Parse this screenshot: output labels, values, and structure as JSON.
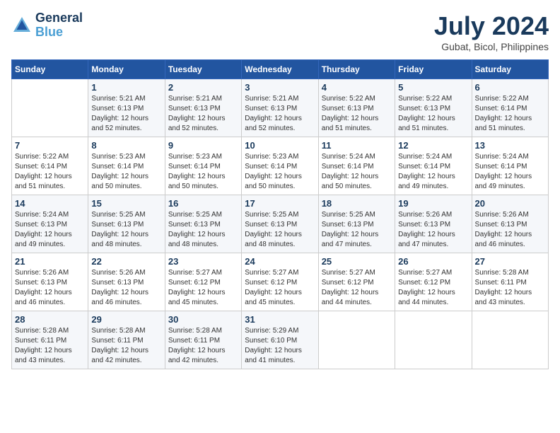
{
  "header": {
    "logo_line1": "General",
    "logo_line2": "Blue",
    "month_title": "July 2024",
    "location": "Gubat, Bicol, Philippines"
  },
  "days_of_week": [
    "Sunday",
    "Monday",
    "Tuesday",
    "Wednesday",
    "Thursday",
    "Friday",
    "Saturday"
  ],
  "weeks": [
    [
      {
        "day": "",
        "info": ""
      },
      {
        "day": "1",
        "info": "Sunrise: 5:21 AM\nSunset: 6:13 PM\nDaylight: 12 hours\nand 52 minutes."
      },
      {
        "day": "2",
        "info": "Sunrise: 5:21 AM\nSunset: 6:13 PM\nDaylight: 12 hours\nand 52 minutes."
      },
      {
        "day": "3",
        "info": "Sunrise: 5:21 AM\nSunset: 6:13 PM\nDaylight: 12 hours\nand 52 minutes."
      },
      {
        "day": "4",
        "info": "Sunrise: 5:22 AM\nSunset: 6:13 PM\nDaylight: 12 hours\nand 51 minutes."
      },
      {
        "day": "5",
        "info": "Sunrise: 5:22 AM\nSunset: 6:13 PM\nDaylight: 12 hours\nand 51 minutes."
      },
      {
        "day": "6",
        "info": "Sunrise: 5:22 AM\nSunset: 6:14 PM\nDaylight: 12 hours\nand 51 minutes."
      }
    ],
    [
      {
        "day": "7",
        "info": "Sunrise: 5:22 AM\nSunset: 6:14 PM\nDaylight: 12 hours\nand 51 minutes."
      },
      {
        "day": "8",
        "info": "Sunrise: 5:23 AM\nSunset: 6:14 PM\nDaylight: 12 hours\nand 50 minutes."
      },
      {
        "day": "9",
        "info": "Sunrise: 5:23 AM\nSunset: 6:14 PM\nDaylight: 12 hours\nand 50 minutes."
      },
      {
        "day": "10",
        "info": "Sunrise: 5:23 AM\nSunset: 6:14 PM\nDaylight: 12 hours\nand 50 minutes."
      },
      {
        "day": "11",
        "info": "Sunrise: 5:24 AM\nSunset: 6:14 PM\nDaylight: 12 hours\nand 50 minutes."
      },
      {
        "day": "12",
        "info": "Sunrise: 5:24 AM\nSunset: 6:14 PM\nDaylight: 12 hours\nand 49 minutes."
      },
      {
        "day": "13",
        "info": "Sunrise: 5:24 AM\nSunset: 6:14 PM\nDaylight: 12 hours\nand 49 minutes."
      }
    ],
    [
      {
        "day": "14",
        "info": "Sunrise: 5:24 AM\nSunset: 6:13 PM\nDaylight: 12 hours\nand 49 minutes."
      },
      {
        "day": "15",
        "info": "Sunrise: 5:25 AM\nSunset: 6:13 PM\nDaylight: 12 hours\nand 48 minutes."
      },
      {
        "day": "16",
        "info": "Sunrise: 5:25 AM\nSunset: 6:13 PM\nDaylight: 12 hours\nand 48 minutes."
      },
      {
        "day": "17",
        "info": "Sunrise: 5:25 AM\nSunset: 6:13 PM\nDaylight: 12 hours\nand 48 minutes."
      },
      {
        "day": "18",
        "info": "Sunrise: 5:25 AM\nSunset: 6:13 PM\nDaylight: 12 hours\nand 47 minutes."
      },
      {
        "day": "19",
        "info": "Sunrise: 5:26 AM\nSunset: 6:13 PM\nDaylight: 12 hours\nand 47 minutes."
      },
      {
        "day": "20",
        "info": "Sunrise: 5:26 AM\nSunset: 6:13 PM\nDaylight: 12 hours\nand 46 minutes."
      }
    ],
    [
      {
        "day": "21",
        "info": "Sunrise: 5:26 AM\nSunset: 6:13 PM\nDaylight: 12 hours\nand 46 minutes."
      },
      {
        "day": "22",
        "info": "Sunrise: 5:26 AM\nSunset: 6:13 PM\nDaylight: 12 hours\nand 46 minutes."
      },
      {
        "day": "23",
        "info": "Sunrise: 5:27 AM\nSunset: 6:12 PM\nDaylight: 12 hours\nand 45 minutes."
      },
      {
        "day": "24",
        "info": "Sunrise: 5:27 AM\nSunset: 6:12 PM\nDaylight: 12 hours\nand 45 minutes."
      },
      {
        "day": "25",
        "info": "Sunrise: 5:27 AM\nSunset: 6:12 PM\nDaylight: 12 hours\nand 44 minutes."
      },
      {
        "day": "26",
        "info": "Sunrise: 5:27 AM\nSunset: 6:12 PM\nDaylight: 12 hours\nand 44 minutes."
      },
      {
        "day": "27",
        "info": "Sunrise: 5:28 AM\nSunset: 6:11 PM\nDaylight: 12 hours\nand 43 minutes."
      }
    ],
    [
      {
        "day": "28",
        "info": "Sunrise: 5:28 AM\nSunset: 6:11 PM\nDaylight: 12 hours\nand 43 minutes."
      },
      {
        "day": "29",
        "info": "Sunrise: 5:28 AM\nSunset: 6:11 PM\nDaylight: 12 hours\nand 42 minutes."
      },
      {
        "day": "30",
        "info": "Sunrise: 5:28 AM\nSunset: 6:11 PM\nDaylight: 12 hours\nand 42 minutes."
      },
      {
        "day": "31",
        "info": "Sunrise: 5:29 AM\nSunset: 6:10 PM\nDaylight: 12 hours\nand 41 minutes."
      },
      {
        "day": "",
        "info": ""
      },
      {
        "day": "",
        "info": ""
      },
      {
        "day": "",
        "info": ""
      }
    ]
  ]
}
